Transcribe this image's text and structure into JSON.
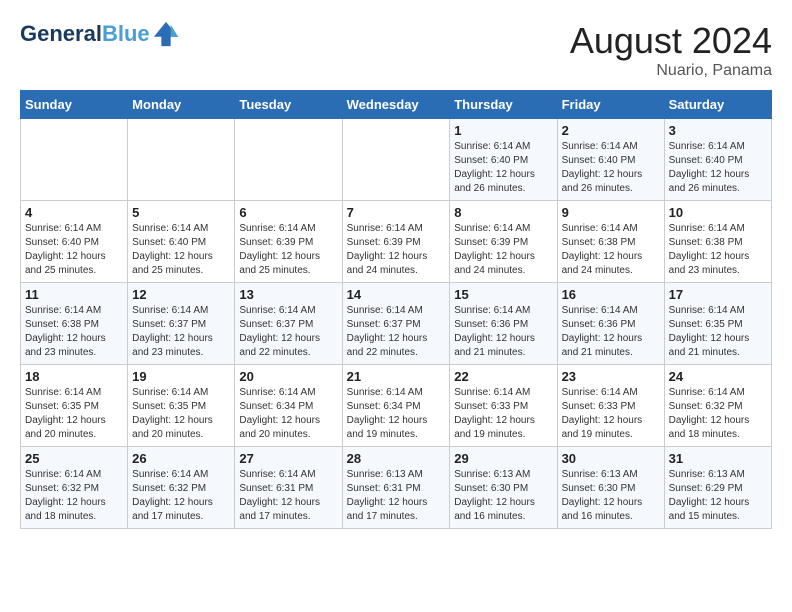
{
  "header": {
    "logo_line1": "General",
    "logo_line2": "Blue",
    "month_year": "August 2024",
    "location": "Nuario, Panama"
  },
  "days_of_week": [
    "Sunday",
    "Monday",
    "Tuesday",
    "Wednesday",
    "Thursday",
    "Friday",
    "Saturday"
  ],
  "weeks": [
    [
      {
        "day": "",
        "info": ""
      },
      {
        "day": "",
        "info": ""
      },
      {
        "day": "",
        "info": ""
      },
      {
        "day": "",
        "info": ""
      },
      {
        "day": "1",
        "info": "Sunrise: 6:14 AM\nSunset: 6:40 PM\nDaylight: 12 hours\nand 26 minutes."
      },
      {
        "day": "2",
        "info": "Sunrise: 6:14 AM\nSunset: 6:40 PM\nDaylight: 12 hours\nand 26 minutes."
      },
      {
        "day": "3",
        "info": "Sunrise: 6:14 AM\nSunset: 6:40 PM\nDaylight: 12 hours\nand 26 minutes."
      }
    ],
    [
      {
        "day": "4",
        "info": "Sunrise: 6:14 AM\nSunset: 6:40 PM\nDaylight: 12 hours\nand 25 minutes."
      },
      {
        "day": "5",
        "info": "Sunrise: 6:14 AM\nSunset: 6:40 PM\nDaylight: 12 hours\nand 25 minutes."
      },
      {
        "day": "6",
        "info": "Sunrise: 6:14 AM\nSunset: 6:39 PM\nDaylight: 12 hours\nand 25 minutes."
      },
      {
        "day": "7",
        "info": "Sunrise: 6:14 AM\nSunset: 6:39 PM\nDaylight: 12 hours\nand 24 minutes."
      },
      {
        "day": "8",
        "info": "Sunrise: 6:14 AM\nSunset: 6:39 PM\nDaylight: 12 hours\nand 24 minutes."
      },
      {
        "day": "9",
        "info": "Sunrise: 6:14 AM\nSunset: 6:38 PM\nDaylight: 12 hours\nand 24 minutes."
      },
      {
        "day": "10",
        "info": "Sunrise: 6:14 AM\nSunset: 6:38 PM\nDaylight: 12 hours\nand 23 minutes."
      }
    ],
    [
      {
        "day": "11",
        "info": "Sunrise: 6:14 AM\nSunset: 6:38 PM\nDaylight: 12 hours\nand 23 minutes."
      },
      {
        "day": "12",
        "info": "Sunrise: 6:14 AM\nSunset: 6:37 PM\nDaylight: 12 hours\nand 23 minutes."
      },
      {
        "day": "13",
        "info": "Sunrise: 6:14 AM\nSunset: 6:37 PM\nDaylight: 12 hours\nand 22 minutes."
      },
      {
        "day": "14",
        "info": "Sunrise: 6:14 AM\nSunset: 6:37 PM\nDaylight: 12 hours\nand 22 minutes."
      },
      {
        "day": "15",
        "info": "Sunrise: 6:14 AM\nSunset: 6:36 PM\nDaylight: 12 hours\nand 21 minutes."
      },
      {
        "day": "16",
        "info": "Sunrise: 6:14 AM\nSunset: 6:36 PM\nDaylight: 12 hours\nand 21 minutes."
      },
      {
        "day": "17",
        "info": "Sunrise: 6:14 AM\nSunset: 6:35 PM\nDaylight: 12 hours\nand 21 minutes."
      }
    ],
    [
      {
        "day": "18",
        "info": "Sunrise: 6:14 AM\nSunset: 6:35 PM\nDaylight: 12 hours\nand 20 minutes."
      },
      {
        "day": "19",
        "info": "Sunrise: 6:14 AM\nSunset: 6:35 PM\nDaylight: 12 hours\nand 20 minutes."
      },
      {
        "day": "20",
        "info": "Sunrise: 6:14 AM\nSunset: 6:34 PM\nDaylight: 12 hours\nand 20 minutes."
      },
      {
        "day": "21",
        "info": "Sunrise: 6:14 AM\nSunset: 6:34 PM\nDaylight: 12 hours\nand 19 minutes."
      },
      {
        "day": "22",
        "info": "Sunrise: 6:14 AM\nSunset: 6:33 PM\nDaylight: 12 hours\nand 19 minutes."
      },
      {
        "day": "23",
        "info": "Sunrise: 6:14 AM\nSunset: 6:33 PM\nDaylight: 12 hours\nand 19 minutes."
      },
      {
        "day": "24",
        "info": "Sunrise: 6:14 AM\nSunset: 6:32 PM\nDaylight: 12 hours\nand 18 minutes."
      }
    ],
    [
      {
        "day": "25",
        "info": "Sunrise: 6:14 AM\nSunset: 6:32 PM\nDaylight: 12 hours\nand 18 minutes."
      },
      {
        "day": "26",
        "info": "Sunrise: 6:14 AM\nSunset: 6:32 PM\nDaylight: 12 hours\nand 17 minutes."
      },
      {
        "day": "27",
        "info": "Sunrise: 6:14 AM\nSunset: 6:31 PM\nDaylight: 12 hours\nand 17 minutes."
      },
      {
        "day": "28",
        "info": "Sunrise: 6:13 AM\nSunset: 6:31 PM\nDaylight: 12 hours\nand 17 minutes."
      },
      {
        "day": "29",
        "info": "Sunrise: 6:13 AM\nSunset: 6:30 PM\nDaylight: 12 hours\nand 16 minutes."
      },
      {
        "day": "30",
        "info": "Sunrise: 6:13 AM\nSunset: 6:30 PM\nDaylight: 12 hours\nand 16 minutes."
      },
      {
        "day": "31",
        "info": "Sunrise: 6:13 AM\nSunset: 6:29 PM\nDaylight: 12 hours\nand 15 minutes."
      }
    ]
  ]
}
